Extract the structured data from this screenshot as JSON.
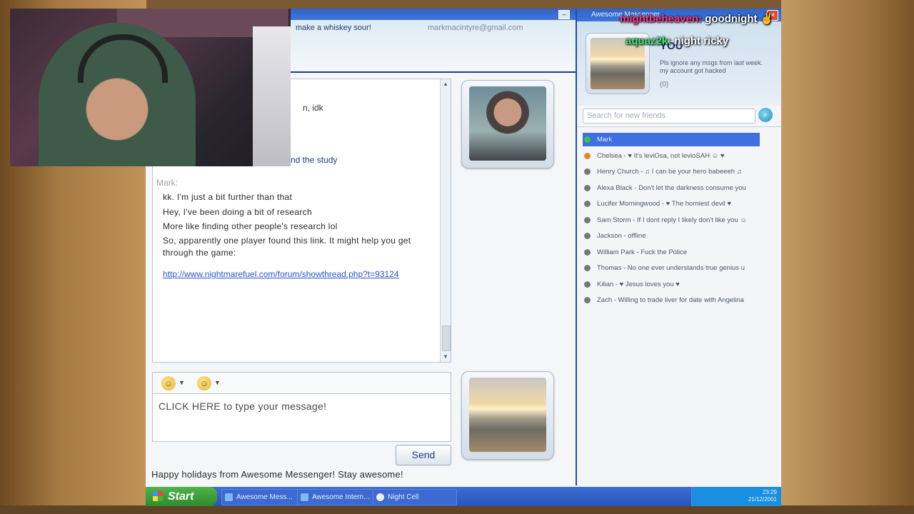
{
  "chat": {
    "status_fragment": "make a whiskey sour!",
    "email": "markmacintyre@gmail.com",
    "partial_lines": [
      "n, idk",
      "nd the study"
    ],
    "sender": "Mark:",
    "messages": [
      "kk. I'm just a bit further than that",
      "Hey, I've been doing a bit of research",
      "More like finding other people's research lol",
      "So, apparently one player found this link. It might help you get through the game:"
    ],
    "link": "http://www.nightmarefuel.com/forum/showthread.php?t=93124",
    "compose_placeholder": "CLICK HERE to type your message!",
    "send_label": "Send",
    "holiday_text": "Happy holidays from Awesome Messenger! Stay awesome!"
  },
  "friends_window": {
    "title": "Awesome Messenger",
    "name": "YOU",
    "status": "Pls ignore any msgs from last week. my account got hacked",
    "reputation": "(0)",
    "search_placeholder": "Search for new friends",
    "friends": [
      {
        "label": "Mark",
        "status": "online",
        "selected": true
      },
      {
        "label": "Chelsea - ♥ It's leviOsa, not levioSAH ☺ ♥",
        "status": "away"
      },
      {
        "label": "Henry Church - ♫ I can be your hero babeeeh ♫",
        "status": "offline"
      },
      {
        "label": "Alexa Black - Don't let the darkness consume you",
        "status": "offline"
      },
      {
        "label": "Lucifer Morningwood - ♥ The horniest devil ♥",
        "status": "offline"
      },
      {
        "label": "Sam Storm - If I dont reply I likely don't like you ☺",
        "status": "offline"
      },
      {
        "label": "Jackson - offline",
        "status": "offline"
      },
      {
        "label": "William Park - Fuck the Police",
        "status": "offline"
      },
      {
        "label": "Thomas - No one ever understands true genius u",
        "status": "offline"
      },
      {
        "label": "Kilian - ♥ Jesus loves you ♥",
        "status": "offline"
      },
      {
        "label": "Zach - Willing to trade liver for date with Angelina",
        "status": "offline"
      }
    ]
  },
  "taskbar": {
    "start_label": "Start",
    "tasks": [
      "Awesome Mess...",
      "Awesome Intern...",
      "Night Cell"
    ],
    "time": "23:29",
    "date": "21/12/2001"
  },
  "overlay": {
    "line1_user": "mightbeheaven:",
    "line1_text": "goodnight ✌",
    "line2_user": "aquaz2k:",
    "line2_text": "night ricky"
  },
  "colors": {
    "accent": "#2f63c8",
    "link": "#2c57c6",
    "selected_row": "#3f6fe0"
  }
}
